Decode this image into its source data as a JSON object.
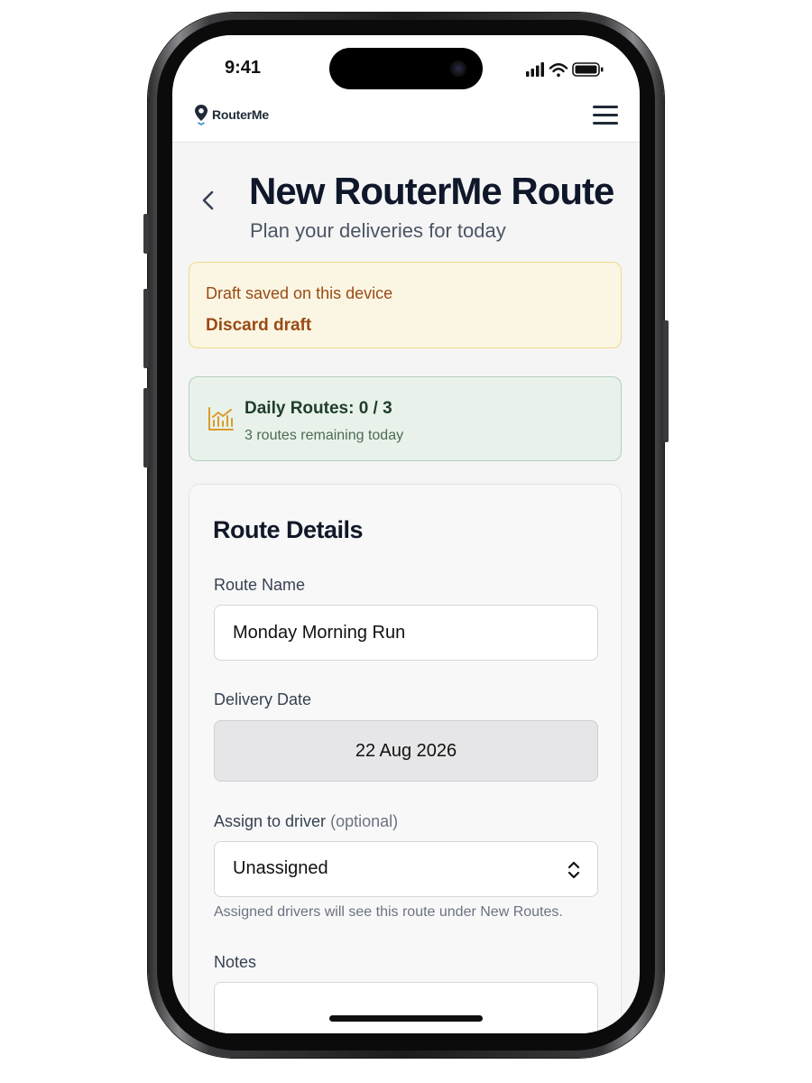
{
  "status_bar": {
    "time": "9:41"
  },
  "header": {
    "brand": "RouterMe"
  },
  "page": {
    "title": "New RouterMe Route",
    "subtitle": "Plan your deliveries for today"
  },
  "draft_banner": {
    "message": "Draft saved on this device",
    "discard_label": "Discard draft"
  },
  "route_limit": {
    "title": "Daily Routes: 0 / 3",
    "subtitle": "3 routes remaining today"
  },
  "route_details": {
    "section_title": "Route Details",
    "route_name": {
      "label": "Route Name",
      "value": "Monday Morning Run"
    },
    "delivery_date": {
      "label": "Delivery Date",
      "value": "22 Aug 2026"
    },
    "driver": {
      "label": "Assign to driver",
      "optional_note": "(optional)",
      "selected": "Unassigned",
      "help": "Assigned drivers will see this route under New Routes."
    },
    "notes": {
      "label": "Notes",
      "value": ""
    }
  },
  "colors": {
    "draft_bg": "#fbf6e3",
    "draft_text": "#9a4a16",
    "limit_bg": "#e8f2ea",
    "limit_icon": "#d89b2b",
    "title": "#0f172a"
  }
}
